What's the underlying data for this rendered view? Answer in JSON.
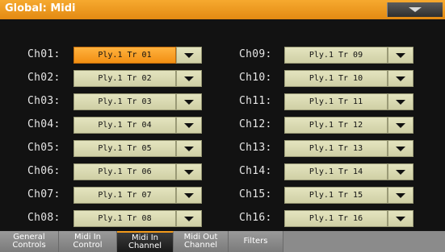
{
  "header": {
    "title": "Global: Midi",
    "menu_icon": "dropdown-triangle-icon"
  },
  "colors": {
    "accent": "#f29a1c",
    "field": "#dcdcb4",
    "selected_field": "#ffa733",
    "background": "#121212"
  },
  "channels": [
    {
      "label": "Ch01:",
      "value": "Ply.1 Tr 01"
    },
    {
      "label": "Ch02:",
      "value": "Ply.1 Tr 02"
    },
    {
      "label": "Ch03:",
      "value": "Ply.1 Tr 03"
    },
    {
      "label": "Ch04:",
      "value": "Ply.1 Tr 04"
    },
    {
      "label": "Ch05:",
      "value": "Ply.1 Tr 05"
    },
    {
      "label": "Ch06:",
      "value": "Ply.1 Tr 06"
    },
    {
      "label": "Ch07:",
      "value": "Ply.1 Tr 07"
    },
    {
      "label": "Ch08:",
      "value": "Ply.1 Tr 08"
    },
    {
      "label": "Ch09:",
      "value": "Ply.1 Tr 09"
    },
    {
      "label": "Ch10:",
      "value": "Ply.1 Tr 10"
    },
    {
      "label": "Ch11:",
      "value": "Ply.1 Tr 11"
    },
    {
      "label": "Ch12:",
      "value": "Ply.1 Tr 12"
    },
    {
      "label": "Ch13:",
      "value": "Ply.1 Tr 13"
    },
    {
      "label": "Ch14:",
      "value": "Ply.1 Tr 14"
    },
    {
      "label": "Ch15:",
      "value": "Ply.1 Tr 15"
    },
    {
      "label": "Ch16:",
      "value": "Ply.1 Tr 16"
    }
  ],
  "selected_channel": "Ch01:",
  "tabs": [
    {
      "line1": "General",
      "line2": "Controls",
      "active": false
    },
    {
      "line1": "Midi In",
      "line2": "Control",
      "active": false
    },
    {
      "line1": "Midi In",
      "line2": "Channel",
      "active": true
    },
    {
      "line1": "Midi Out",
      "line2": "Channel",
      "active": false
    },
    {
      "line1": "Filters",
      "line2": "",
      "active": false
    }
  ]
}
